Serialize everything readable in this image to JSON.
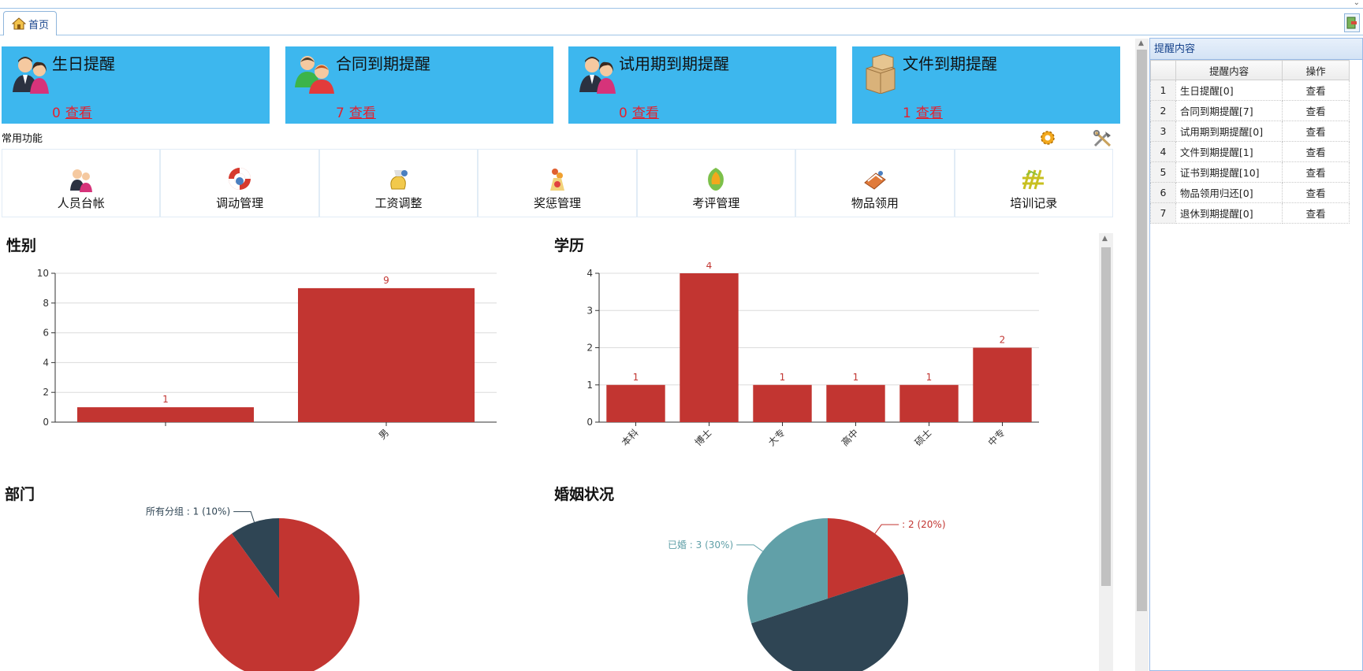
{
  "tabs": [
    {
      "label": "首页",
      "icon": "home-icon"
    }
  ],
  "cards": [
    {
      "title": "生日提醒",
      "count": "0",
      "link": "查看",
      "icon": "couple-icon"
    },
    {
      "title": "合同到期提醒",
      "count": "7",
      "link": "查看",
      "icon": "users-icon"
    },
    {
      "title": "试用期到期提醒",
      "count": "0",
      "link": "查看",
      "icon": "couple-icon"
    },
    {
      "title": "文件到期提醒",
      "count": "1",
      "link": "查看",
      "icon": "boxes-icon"
    }
  ],
  "common_functions": {
    "title": "常用功能",
    "items": [
      {
        "label": "人员台帐",
        "icon": "people-icon"
      },
      {
        "label": "调动管理",
        "icon": "lifebuoy-icon"
      },
      {
        "label": "工资调整",
        "icon": "money-bag-icon"
      },
      {
        "label": "奖惩管理",
        "icon": "medal-icon"
      },
      {
        "label": "考评管理",
        "icon": "evaluation-icon"
      },
      {
        "label": "物品领用",
        "icon": "goods-icon"
      },
      {
        "label": "培训记录",
        "icon": "training-icon"
      }
    ]
  },
  "charts": {
    "gender_title": "性别",
    "education_title": "学历",
    "department_title": "部门",
    "marital_title": "婚姻状况"
  },
  "chart_data": [
    {
      "type": "bar",
      "title": "性别",
      "categories": [
        "",
        "男"
      ],
      "values": [
        1,
        9
      ],
      "ylim": [
        0,
        10
      ],
      "yticks": [
        0,
        2,
        4,
        6,
        8,
        10
      ],
      "grid": true,
      "color": "#c23531"
    },
    {
      "type": "bar",
      "title": "学历",
      "categories": [
        "本科",
        "博士",
        "大专",
        "高中",
        "硕士",
        "中专"
      ],
      "values": [
        1,
        4,
        1,
        1,
        1,
        2
      ],
      "ylim": [
        0,
        4
      ],
      "yticks": [
        0,
        1,
        2,
        3,
        4
      ],
      "grid": true,
      "color": "#c23531"
    },
    {
      "type": "pie",
      "title": "部门",
      "slices": [
        {
          "name": "所有分组",
          "value": 1,
          "percent": "10%",
          "color": "#2f4554"
        },
        {
          "name": "",
          "value": 9,
          "percent": "90%",
          "color": "#c23531"
        }
      ]
    },
    {
      "type": "pie",
      "title": "婚姻状况",
      "slices": [
        {
          "name": "",
          "value": 2,
          "percent": "20%",
          "color": "#c23531"
        },
        {
          "name": "",
          "value": 5,
          "percent": "50%",
          "color": "#2f4554"
        },
        {
          "name": "已婚",
          "value": 3,
          "percent": "30%",
          "color": "#61a0a8"
        }
      ]
    }
  ],
  "reminder_panel": {
    "title": "提醒内容",
    "columns": [
      "提醒内容",
      "操作"
    ],
    "rows": [
      {
        "n": "1",
        "content": "生日提醒[0]",
        "action": "查看"
      },
      {
        "n": "2",
        "content": "合同到期提醒[7]",
        "action": "查看"
      },
      {
        "n": "3",
        "content": "试用期到期提醒[0]",
        "action": "查看"
      },
      {
        "n": "4",
        "content": "文件到期提醒[1]",
        "action": "查看"
      },
      {
        "n": "5",
        "content": "证书到期提醒[10]",
        "action": "查看"
      },
      {
        "n": "6",
        "content": "物品领用归还[0]",
        "action": "查看"
      },
      {
        "n": "7",
        "content": "退休到期提醒[0]",
        "action": "查看"
      }
    ]
  },
  "colors": {
    "card_bg": "#3db7ee",
    "accent_red": "#c23531",
    "count_red": "#e2212f",
    "dark": "#2f4554",
    "teal": "#61a0a8"
  }
}
